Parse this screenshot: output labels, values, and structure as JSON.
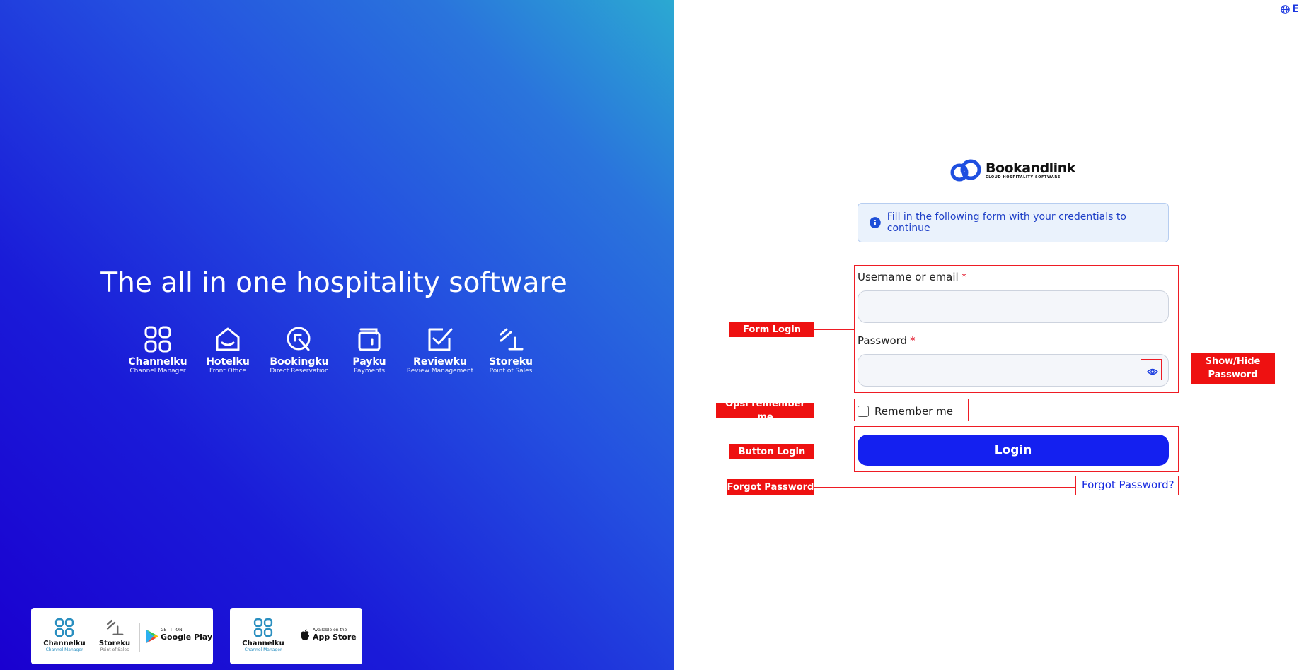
{
  "language": {
    "label": "E"
  },
  "hero": {
    "headline": "The all in one hospitality software",
    "products": [
      {
        "name": "Channelku",
        "subtitle": "Channel Manager"
      },
      {
        "name": "Hotelku",
        "subtitle": "Front Office"
      },
      {
        "name": "Bookingku",
        "subtitle": "Direct Reservation"
      },
      {
        "name": "Payku",
        "subtitle": "Payments"
      },
      {
        "name": "Reviewku",
        "subtitle": "Review Management"
      },
      {
        "name": "Storeku",
        "subtitle": "Point of Sales"
      }
    ],
    "google_play_card": {
      "apps": [
        {
          "name": "Channelku",
          "subtitle": "Channel Manager"
        },
        {
          "name": "Storeku",
          "subtitle": "Point of Sales"
        }
      ],
      "badge_small": "GET IT ON",
      "badge_big": "Google Play"
    },
    "app_store_card": {
      "apps": [
        {
          "name": "Channelku",
          "subtitle": "Channel Manager"
        }
      ],
      "badge_small": "Available on the",
      "badge_big": "App Store"
    }
  },
  "logo": {
    "brand": "Bookandlink",
    "tagline": "CLOUD HOSPITALITY SOFTWARE"
  },
  "info_message": "Fill in the following form with your credentials to continue",
  "form": {
    "username_label": "Username or email",
    "password_label": "Password",
    "required_mark": "*",
    "username_value": "",
    "password_value": "",
    "remember_label": "Remember me",
    "login_label": "Login",
    "forgot_label": "Forgot Password?"
  },
  "annotations": {
    "form_login": "Form Login",
    "show_hide_password": "Show/Hide Password",
    "remember_option": "Opsi remember me",
    "button_login": "Button Login",
    "forgot_password": "Forgot Password"
  },
  "colors": {
    "primary": "#1420f0",
    "annotation_red": "#ee1111",
    "info_background": "#eaf2fc",
    "info_text": "#1e3fc7",
    "hero_gradient_top_right": "#2ba9d2",
    "hero_gradient_bottom_left": "#1a00d0"
  },
  "icons": {
    "language": "globe-icon",
    "info": "info-circle-icon",
    "password_toggle": "eye-icon"
  }
}
